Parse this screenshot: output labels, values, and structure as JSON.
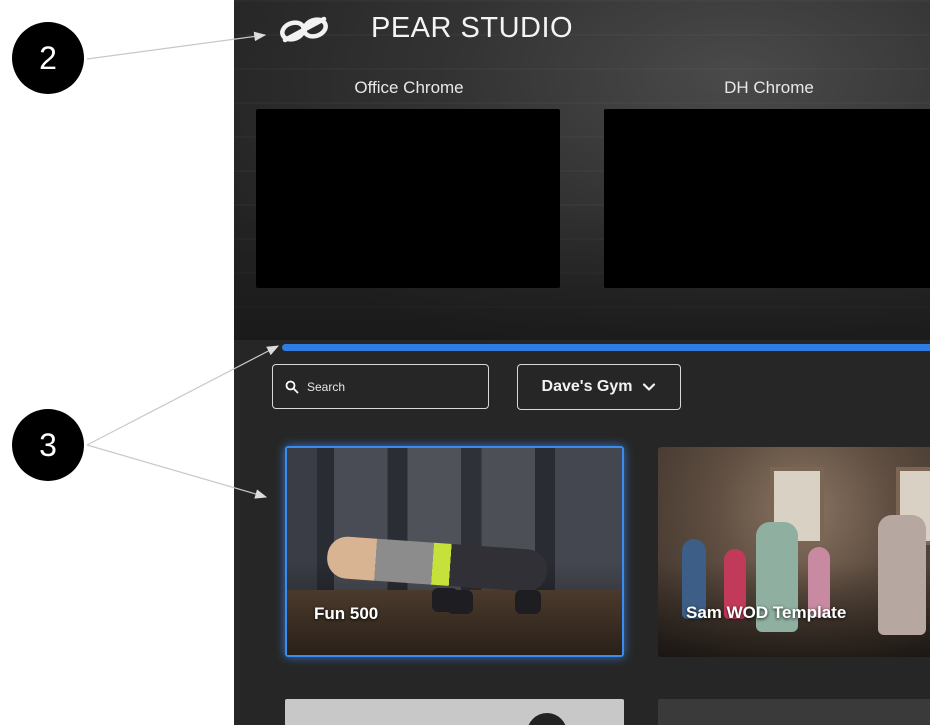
{
  "annotations": {
    "callout_2": "2",
    "callout_3": "3"
  },
  "header": {
    "brand": "PEAR STUDIO",
    "logo_icon": "pear-infinity-logo-icon"
  },
  "screens": [
    {
      "label": "Office Chrome"
    },
    {
      "label": "DH Chrome"
    }
  ],
  "progress": {
    "fraction": 1.0,
    "color": "#2f7de0"
  },
  "filters": {
    "search": {
      "placeholder": "Search",
      "icon": "search-icon"
    },
    "gym_select": {
      "value": "Dave's Gym",
      "icon": "chevron-down-icon"
    }
  },
  "workouts": [
    {
      "title": "Fun 500",
      "selected": true
    },
    {
      "title": "Sam WOD Template",
      "selected": false
    }
  ],
  "colors": {
    "accent": "#3b8bf0",
    "background": "#262626"
  }
}
